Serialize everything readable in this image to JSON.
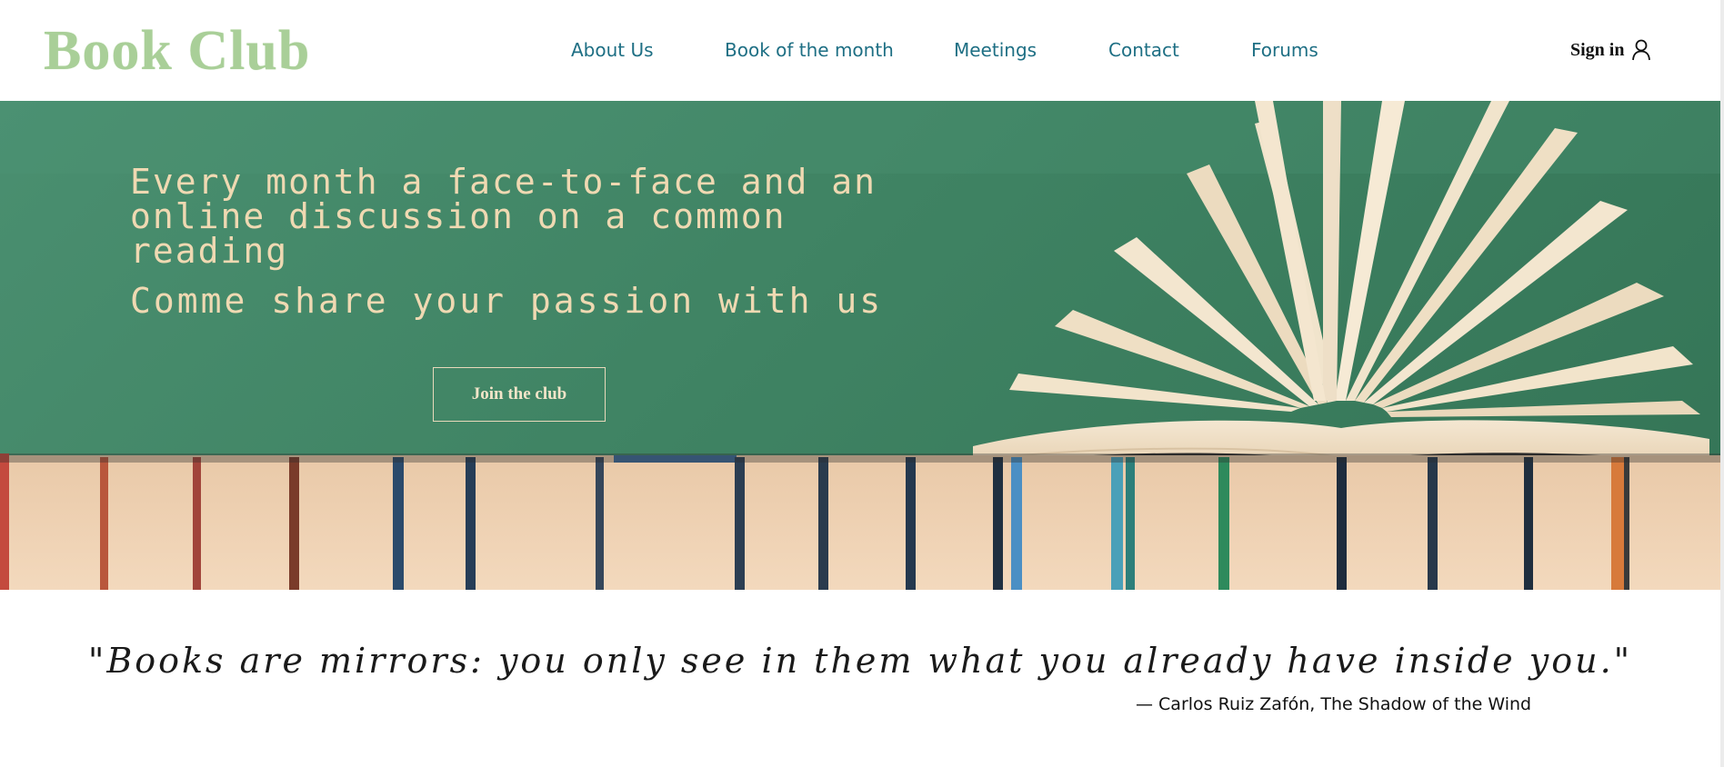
{
  "header": {
    "logo": "Book Club",
    "nav": [
      {
        "label": "About Us",
        "name": "nav-about-us"
      },
      {
        "label": "Book of the month",
        "name": "nav-book-of-the-month"
      },
      {
        "label": "Meetings",
        "name": "nav-meetings"
      },
      {
        "label": "Contact",
        "name": "nav-contact"
      },
      {
        "label": "Forums",
        "name": "nav-forums"
      }
    ],
    "signin": {
      "label": "Sign in",
      "icon": "user-icon"
    }
  },
  "hero": {
    "title": "Every month a face-to-face and an online discussion on a common reading",
    "subtitle": "Comme share your passion with us",
    "button": "Join the club"
  },
  "quote": {
    "text": "\"Books are mirrors: you only see in them what you already have inside you.\"",
    "author": "— Carlos Ruiz Zafón, The Shadow of the Wind"
  },
  "colors": {
    "logo": "#a9cf98",
    "nav": "#1e6f84",
    "hero_bg": "#3f8363",
    "hero_text": "#efd9b2"
  }
}
